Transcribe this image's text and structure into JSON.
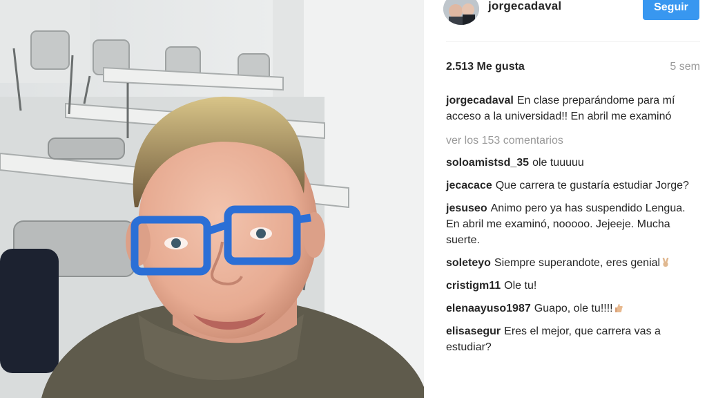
{
  "post": {
    "username": "jorgecadaval",
    "follow_label": "Seguir",
    "likes": "2.513 Me gusta",
    "time": "5 sem",
    "caption": "En clase preparándome para mí acceso a la universidad!! En abril me examinó",
    "view_all": "ver los 153 comentarios"
  },
  "comments": [
    {
      "user": "soloamistsd_35",
      "text": "ole tuuuuu"
    },
    {
      "user": "jecacace",
      "text": "Que carrera te gustaría estudiar Jorge?"
    },
    {
      "user": "jesuseo",
      "text": "Animo pero ya has suspendido Lengua. En abril me examinó, nooooo. Jejeeje. Mucha suerte."
    },
    {
      "user": "soleteyo",
      "text": "Siempre superandote, eres genial",
      "emoji": "victory-hand-emoji"
    },
    {
      "user": "cristigm11",
      "text": "Ole tu!"
    },
    {
      "user": "elenaayuso1987",
      "text": "Guapo, ole tu!!!!",
      "emoji": "thumbs-up-emoji"
    },
    {
      "user": "elisasegur",
      "text": "Eres el mejor, que carrera vas a estudiar?"
    }
  ],
  "colors": {
    "follow_button": "#3897f0",
    "text": "#262626",
    "muted": "#999999",
    "glasses": "#2b6fd6"
  }
}
